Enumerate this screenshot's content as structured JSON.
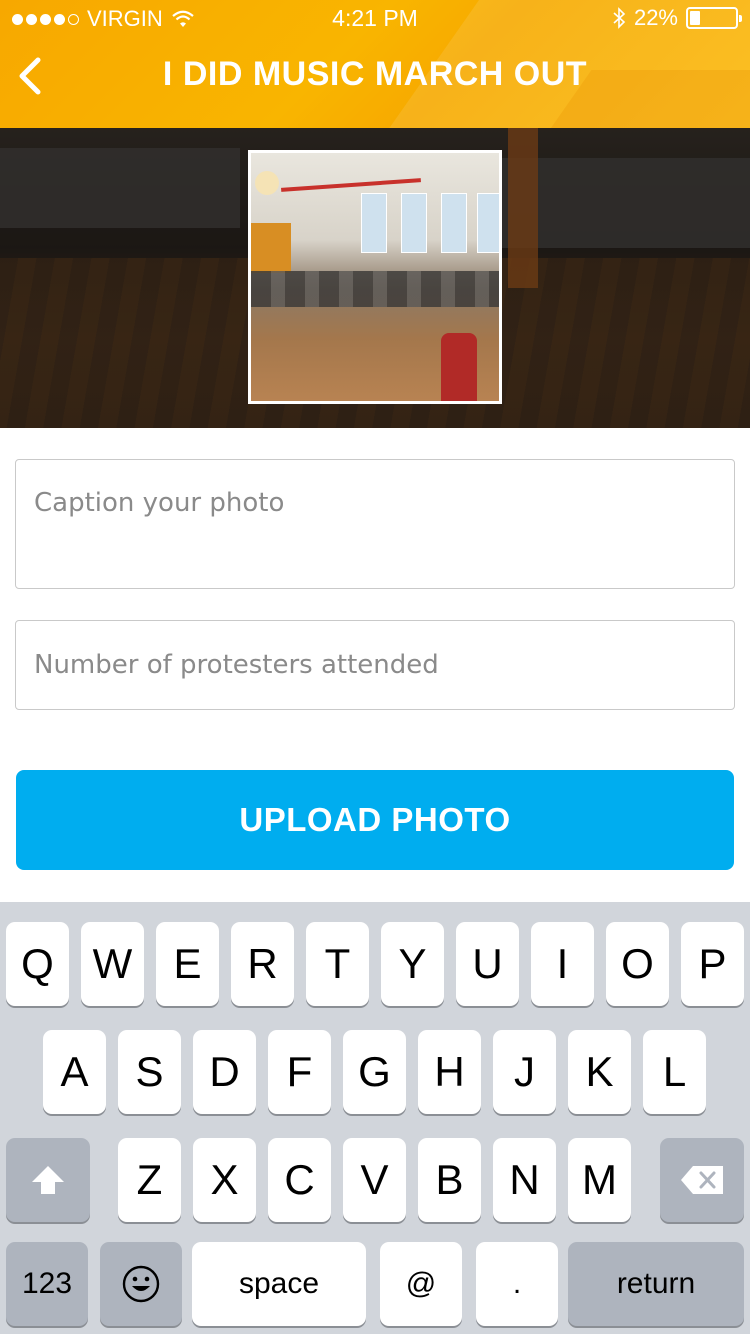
{
  "status_bar": {
    "carrier": "VIRGIN",
    "time": "4:21 PM",
    "battery": "22%",
    "battery_level": 0.22,
    "signal_bars_filled": 4,
    "signal_bars_total": 5
  },
  "header": {
    "title": "I DID MUSIC MARCH OUT",
    "back_icon": "chevron-left-icon",
    "accent_color": "#f9b000"
  },
  "form": {
    "caption_placeholder": "Caption your photo",
    "protesters_placeholder": "Number of protesters attended",
    "upload_label": "UPLOAD PHOTO",
    "button_color": "#00adef"
  },
  "keyboard": {
    "row1": [
      "Q",
      "W",
      "E",
      "R",
      "T",
      "Y",
      "U",
      "I",
      "O",
      "P"
    ],
    "row2": [
      "A",
      "S",
      "D",
      "F",
      "G",
      "H",
      "J",
      "K",
      "L"
    ],
    "row3": [
      "Z",
      "X",
      "C",
      "V",
      "B",
      "N",
      "M"
    ],
    "numbers_label": "123",
    "space_label": "space",
    "at_label": "@",
    "period_label": ".",
    "return_label": "return",
    "shift_icon": "shift-arrow-icon",
    "delete_icon": "backspace-icon",
    "emoji_icon": "emoji-icon"
  }
}
